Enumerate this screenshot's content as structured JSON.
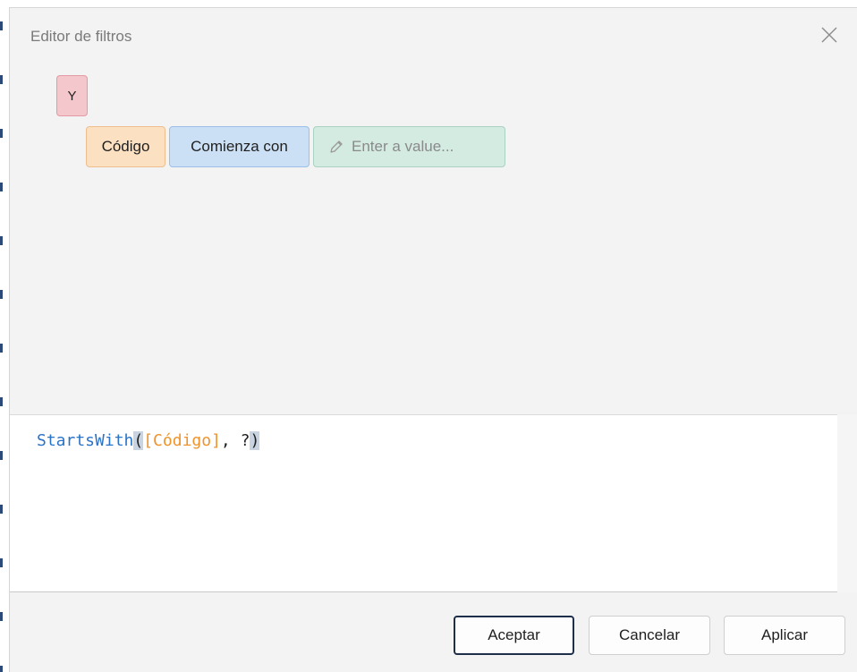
{
  "dialog": {
    "title": "Editor de filtros",
    "close_icon": "close-icon"
  },
  "filter_tree": {
    "group_operator": "Y",
    "condition": {
      "field": "Código",
      "operator": "Comienza con",
      "value_placeholder": "Enter a value...",
      "value_icon": "pencil-icon"
    }
  },
  "expression": {
    "function": "StartsWith",
    "open_paren": "(",
    "field": "[Código]",
    "separator": ", ",
    "parameter": "?",
    "close_paren": ")"
  },
  "footer": {
    "accept_label": "Aceptar",
    "cancel_label": "Cancelar",
    "apply_label": "Aplicar"
  },
  "colors": {
    "group_chip": "#f4c7cc",
    "field_chip": "#fbe0c2",
    "operator_chip": "#cce0f5",
    "value_chip": "#d4ebe2",
    "function_text": "#2b73c8",
    "field_text": "#f0932b"
  }
}
